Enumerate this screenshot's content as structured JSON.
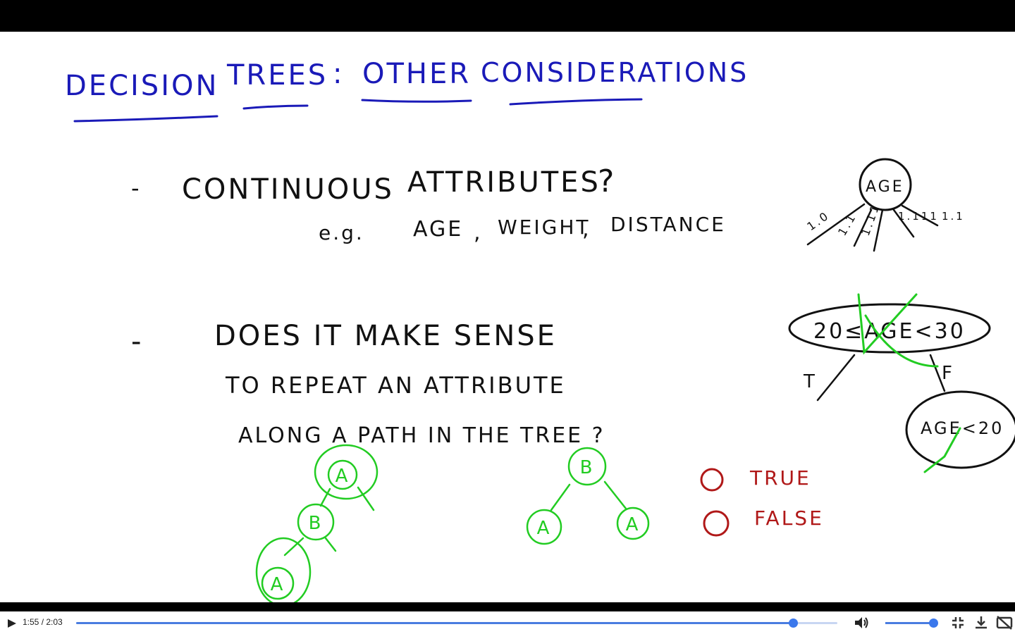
{
  "slide": {
    "title_words": [
      "DECISION",
      "TREES",
      ":",
      "OTHER",
      "CONSIDERATIONS"
    ],
    "bullet1_line1": [
      "-",
      "CONTINUOUS",
      "ATTRIBUTES",
      "?"
    ],
    "bullet1_line2": [
      "e.g.",
      "AGE",
      ",",
      "WEIGHT",
      ",",
      "DISTANCE"
    ],
    "bullet2_lines": [
      "-",
      "DOES  IT  MAKE  SENSE",
      "TO  REPEAT  AN  ATTRIBUTE",
      "ALONG  A  PATH  IN  THE  TREE ?"
    ],
    "age_node": "AGE",
    "age_branches": [
      "1.0",
      "1.1",
      "1.11",
      "1.111",
      "1.1"
    ],
    "range_node": "20≤AGE<30",
    "range_true": "T",
    "range_false": "F",
    "sub_node": "AGE<20",
    "tree1_nodes": [
      "A",
      "B",
      "A"
    ],
    "tree2_nodes": [
      "B",
      "A",
      "A"
    ],
    "options": [
      "TRUE",
      "FALSE"
    ]
  },
  "player": {
    "time_display": "1:55 / 2:03",
    "progress_fraction": 0.942,
    "volume_fraction": 0.95,
    "colors": {
      "accent": "#3b78ec",
      "ink_blue": "#1a1ab8",
      "ink_black": "#111111",
      "ink_green": "#22cc22",
      "ink_red": "#b01818"
    },
    "icons": [
      "play-icon",
      "volume-icon",
      "exit-fullscreen-icon",
      "download-icon",
      "captions-off-icon"
    ]
  }
}
